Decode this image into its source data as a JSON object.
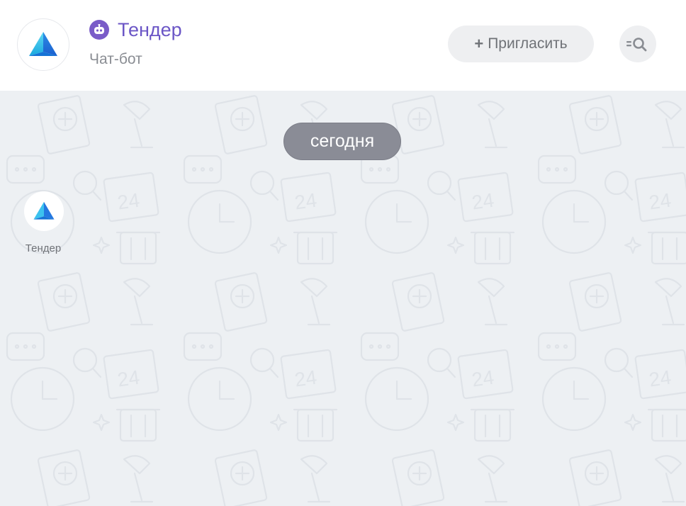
{
  "header": {
    "title": "Тендер",
    "subtitle": "Чат-бот",
    "invite_plus": "+",
    "invite_label": "Пригласить",
    "avatar_icon": "pyramid-logo-icon",
    "bot_icon": "robot-icon",
    "search_icon": "list-search-icon"
  },
  "chat": {
    "date_separator": "сегодня",
    "messages": [
      {
        "sender": "Тендер",
        "avatar_icon": "pyramid-logo-icon"
      }
    ]
  },
  "colors": {
    "accent": "#6b56c6",
    "bot_badge": "#7a5cc8",
    "chat_background": "#edf0f3",
    "date_pill": "#8a8c96",
    "button_background": "#eeeff1"
  }
}
